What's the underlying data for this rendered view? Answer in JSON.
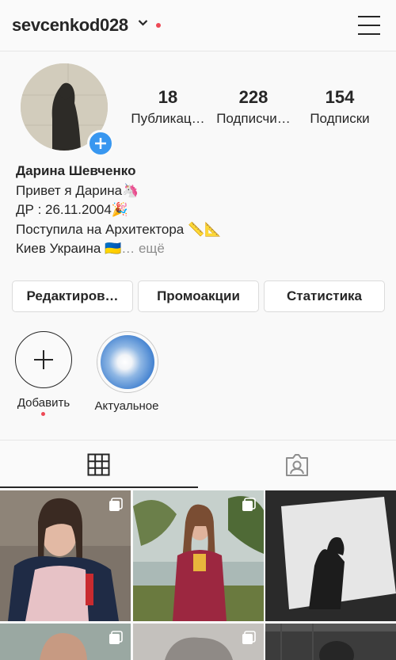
{
  "header": {
    "username": "sevcenkod028",
    "icons": [
      "chevron-down-icon",
      "notification-dot",
      "hamburger-menu-icon"
    ]
  },
  "profile": {
    "stats": [
      {
        "value": "18",
        "label": "Публикац…"
      },
      {
        "value": "228",
        "label": "Подписчи…"
      },
      {
        "value": "154",
        "label": "Подписки"
      }
    ],
    "name": "Дарина Шевченко",
    "bio_lines": [
      "Привет я Дарина🦄",
      "ДР : 26.11.2004🎉",
      "Поступила на Архитектора 📏📐",
      "Киев Украина 🇺🇦"
    ],
    "more_label": "… ещё"
  },
  "buttons": {
    "edit": "Редактиров…",
    "promo": "Промоакции",
    "stats": "Статистика"
  },
  "highlights": [
    {
      "label": "Добавить"
    },
    {
      "label": "Актуальное"
    }
  ],
  "tabs": [
    "grid-icon",
    "tagged-icon"
  ],
  "colors": {
    "accent": "#3897f0",
    "notification": "#ed4956",
    "text": "#262626",
    "muted": "#8e8e8e"
  }
}
